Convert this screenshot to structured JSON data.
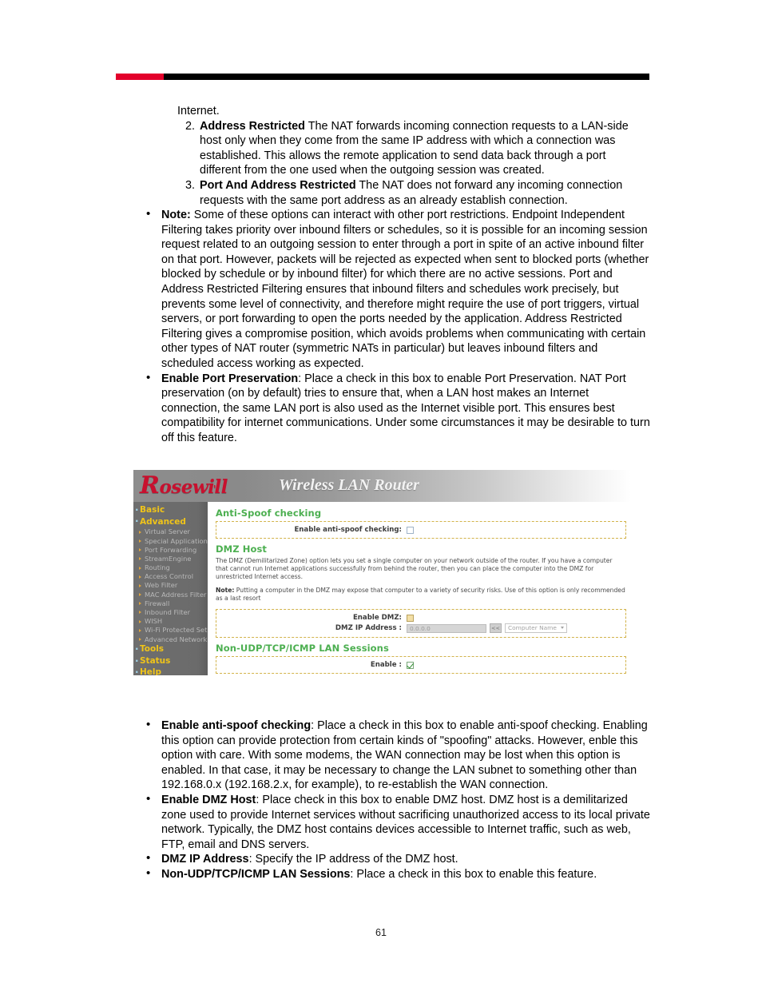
{
  "document": {
    "page_number": "61",
    "intro_line": "Internet.",
    "numbered_items": [
      {
        "num": "2.",
        "term": "Address Restricted",
        "text": " The NAT forwards incoming connection requests to a LAN-side host only when they come from the same IP address with which a connection was established. This allows the remote application to send data back through a port different from the one used when the outgoing session was created."
      },
      {
        "num": "3.",
        "term": "Port And Address Restricted",
        "text": " The NAT does not forward any incoming connection requests with the same port address as an already establish connection."
      }
    ],
    "top_bullets": [
      {
        "term": "Note:",
        "text": " Some of these options can interact with other port restrictions. Endpoint Independent Filtering takes priority over inbound filters or schedules, so it is possible for an incoming session request related to an outgoing session to enter through a port in spite of an active inbound filter on that port. However, packets will be rejected as expected when sent to blocked ports (whether blocked by schedule or by inbound filter) for which there are no active sessions. Port and Address Restricted Filtering ensures that inbound filters and schedules work precisely, but prevents some level of connectivity, and therefore might require the use of port triggers, virtual servers, or port forwarding to open the ports needed by the application. Address Restricted Filtering gives a compromise position, which avoids problems when communicating with certain other types of NAT router (symmetric NATs in particular) but leaves inbound filters and scheduled access working as expected."
      },
      {
        "term": "Enable Port Preservation",
        "text": ":  Place a check in this box to enable Port Preservation. NAT Port preservation (on by default) tries to ensure that, when a LAN host makes an Internet connection, the same LAN port is also used as the Internet visible port. This ensures best compatibility for internet communications. Under some circumstances it may be desirable to turn off this feature."
      }
    ],
    "bottom_bullets": [
      {
        "term": "Enable anti-spoof checking",
        "text": ":  Place a check in this box to enable anti-spoof checking. Enabling this option can provide protection from certain kinds of \"spoofing\" attacks. However, enble this option with care. With some modems, the WAN connection may be lost when this option is enabled. In that case, it may be necessary to change the LAN subnet to something other than 192.168.0.x (192.168.2.x, for example), to re-establish the WAN connection."
      },
      {
        "term": "Enable DMZ Host",
        "text": ": Place check in this box to enable DMZ host. DMZ host is a demilitarized zone used to provide Internet services without sacrificing unauthorized access to its local private network.  Typically, the DMZ host contains devices accessible to Internet traffic, such as web, FTP, email and DNS servers."
      },
      {
        "term": "DMZ IP Address",
        "text": ": Specify the IP address of the DMZ host."
      },
      {
        "term": "Non-UDP/TCP/ICMP LAN Sessions",
        "text": ": Place a check in this box to enable this feature."
      }
    ]
  },
  "router_ui": {
    "brand": "Rosewill",
    "header_title": "Wireless LAN Router",
    "sidebar": {
      "groups": [
        {
          "label": "Basic"
        },
        {
          "label": "Advanced"
        }
      ],
      "advanced_items": [
        {
          "label": "Virtual Server"
        },
        {
          "label": "Special Applications"
        },
        {
          "label": "Port Forwarding"
        },
        {
          "label": "StreamEngine"
        },
        {
          "label": "Routing"
        },
        {
          "label": "Access Control"
        },
        {
          "label": "Web Filter"
        },
        {
          "label": "MAC Address Filter"
        },
        {
          "label": "Firewall"
        },
        {
          "label": "Inbound Filter"
        },
        {
          "label": "WISH"
        },
        {
          "label": "Wi-Fi Protected Setup"
        },
        {
          "label": "Advanced Network"
        }
      ],
      "tail_groups": [
        {
          "label": "Tools"
        },
        {
          "label": "Status"
        },
        {
          "label": "Help"
        }
      ]
    },
    "sections": {
      "antispoof": {
        "heading": "Anti-Spoof checking",
        "enable_label": "Enable anti-spoof checking:",
        "enable_checked": false
      },
      "dmz": {
        "heading": "DMZ Host",
        "description": "The DMZ (Demilitarized Zone) option lets you set a single computer on your network outside of the router. If you have a computer that cannot run Internet applications successfully from behind the router, then you can place the computer into the DMZ for unrestricted Internet access.",
        "note_label": "Note:",
        "note_text": " Putting a computer in the DMZ may expose that computer to a variety of security risks. Use of this option is only recommended as a last resort",
        "enable_label": "Enable DMZ:",
        "enable_checked": false,
        "ip_label": "DMZ IP Address :",
        "ip_value": "0.0.0.0",
        "arrow_button_label": "<<",
        "computer_select_value": "Computer Name"
      },
      "nonudp": {
        "heading": "Non-UDP/TCP/ICMP LAN Sessions",
        "enable_label": "Enable :",
        "enable_checked": true
      }
    }
  },
  "colors": {
    "accent_red": "#e3002b",
    "brand_red": "#c8102e",
    "section_green": "#4caf50",
    "sidebar_yellow": "#f0c419",
    "panel_border": "#d2b34a"
  }
}
